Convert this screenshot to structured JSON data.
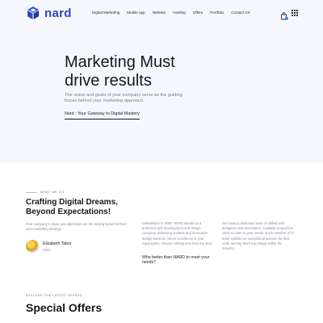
{
  "header": {
    "brand": "nard",
    "nav": [
      "Digital Marketing",
      "Mobile app",
      "Website",
      "Hosting",
      "Offers",
      "Portfolio",
      "Contact US"
    ],
    "cart_count": ""
  },
  "hero": {
    "title_line1": "Marketing Must",
    "title_line2": "drive results",
    "subtitle": "The vision and goals of your company serve as the guiding forces behind your marketing approach.",
    "link": "Nard : Your Gateway to Digital Mastery"
  },
  "what_we_do": {
    "eyebrow": "WHAT WE DO",
    "title_line1": "Crafting Digital Dreams,",
    "title_line2": "Beyond Expectations!",
    "description": "Your company's vision and objectives are the driving factors behind your marketing strategy.",
    "person_name": "Elizabeth Tabor",
    "person_role": "CEO",
    "column2_text": "Established in 2005, NARD stands as a proficient web development and design company, delivering creative and innovative design services. When excellence is your expectation, choose nothing less than the best.",
    "column2_question": "Who better than NARD to meet your needs?",
    "column3_text": "We boast a dedicated team of skilled web designers and developers, available around the clock to cater to your needs. Each member of IT team exhibits an exceptional passion for their craft, earning them top ratings within the industry."
  },
  "offers": {
    "eyebrow": "EXPLORE THE LATEST OFFERS",
    "title": "Special Offers"
  },
  "colors": {
    "brand_blue": "#2d4bb8",
    "hero_bg": "#f5f7fd",
    "cart_badge": "#2d6cdf"
  }
}
